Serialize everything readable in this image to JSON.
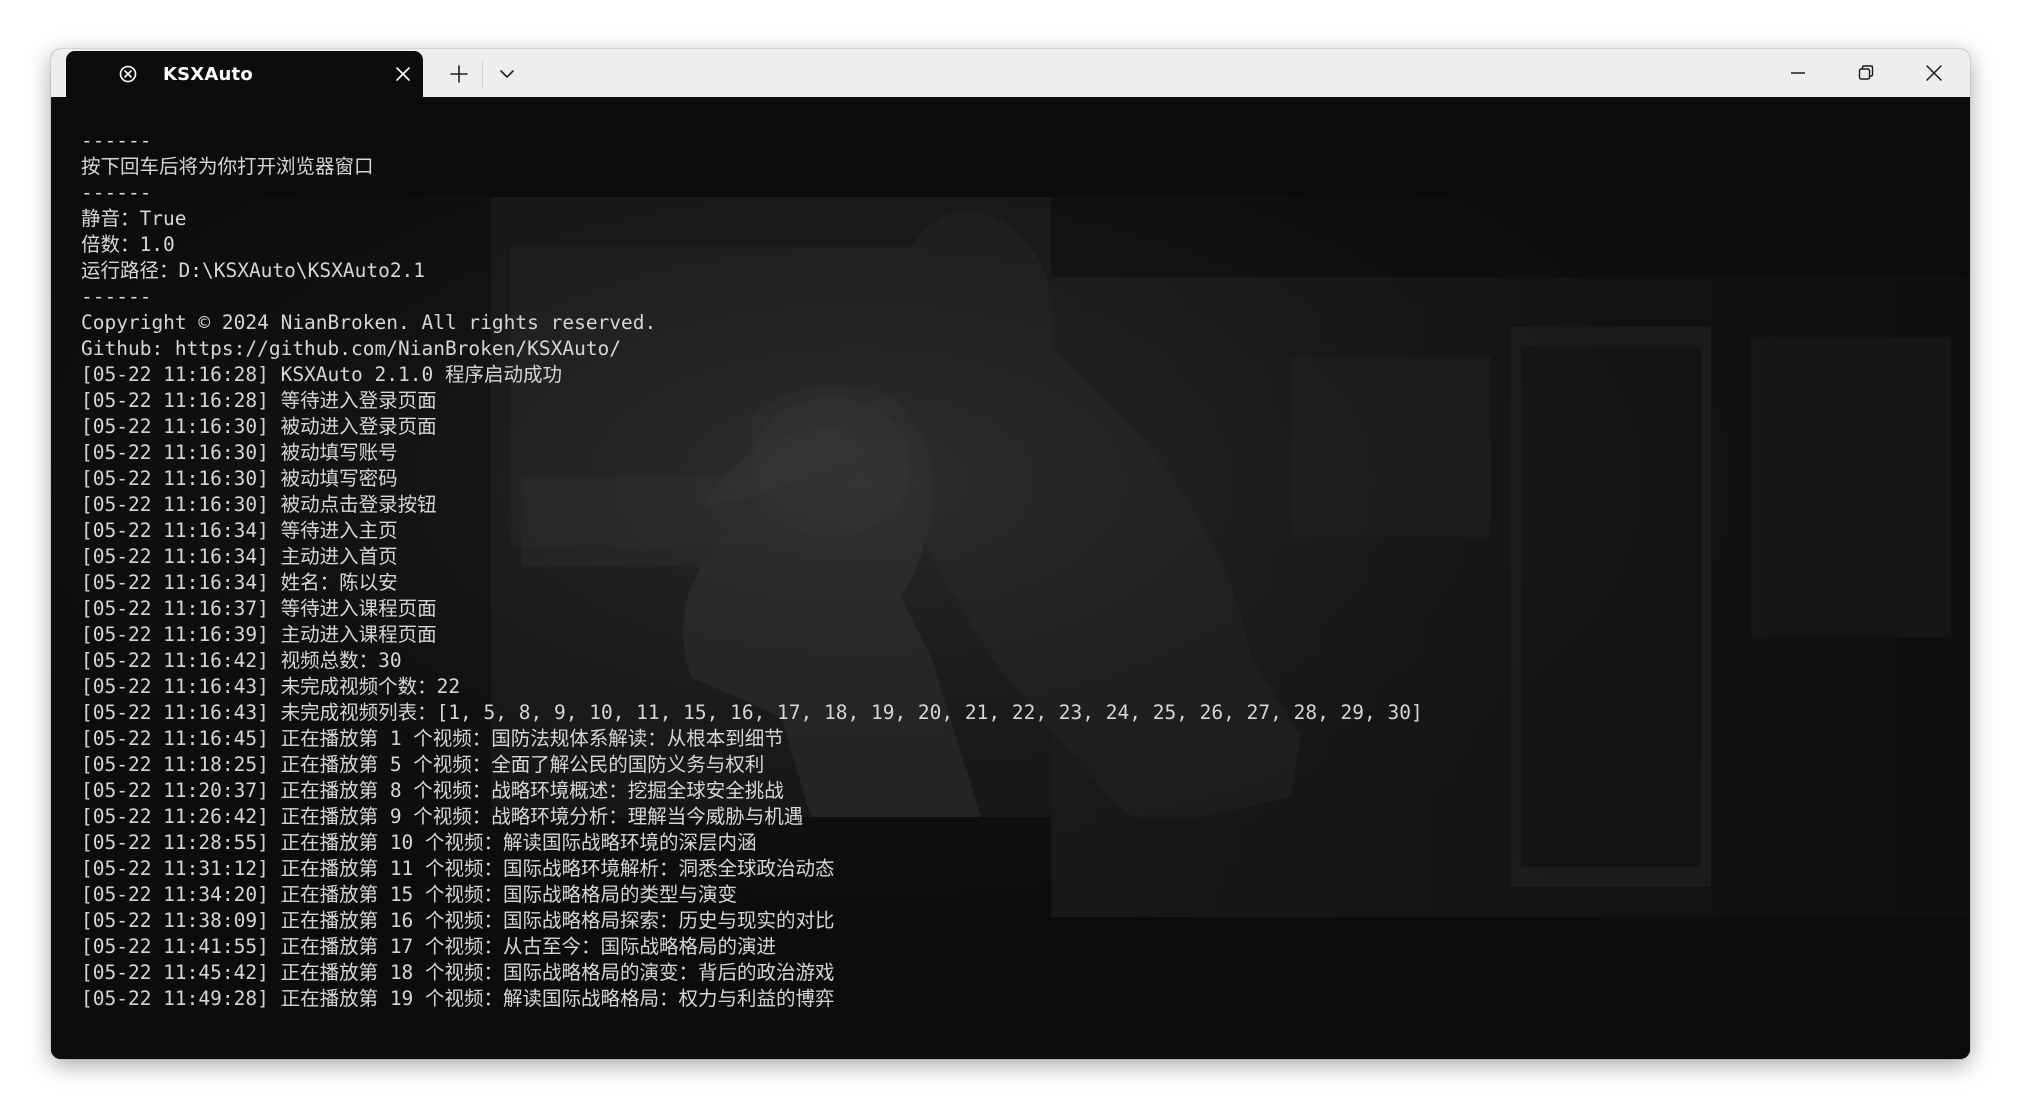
{
  "window": {
    "tab_title": "KSXAuto",
    "icons": {
      "tab_icon": "terminal-app-icon",
      "tab_close": "close-icon",
      "new_tab": "plus-icon",
      "dropdown": "chevron-down-icon",
      "minimize": "minimize-icon",
      "maximize": "restore-icon",
      "close": "close-icon"
    }
  },
  "colors": {
    "titlebar": "#eeeeee",
    "terminal_bg": "#0c0c0c",
    "terminal_text": "#d6d6d6"
  },
  "terminal": {
    "lines": [
      "------",
      "按下回车后将为你打开浏览器窗口",
      "------",
      "静音：True",
      "倍数：1.0",
      "运行路径：D:\\KSXAuto\\KSXAuto2.1",
      "------",
      "Copyright © 2024 NianBroken. All rights reserved.",
      "Github: https://github.com/NianBroken/KSXAuto/",
      "[05-22 11:16:28] KSXAuto 2.1.0 程序启动成功",
      "[05-22 11:16:28] 等待进入登录页面",
      "[05-22 11:16:30] 被动进入登录页面",
      "[05-22 11:16:30] 被动填写账号",
      "[05-22 11:16:30] 被动填写密码",
      "[05-22 11:16:30] 被动点击登录按钮",
      "[05-22 11:16:34] 等待进入主页",
      "[05-22 11:16:34] 主动进入首页",
      "[05-22 11:16:34] 姓名：陈以安",
      "[05-22 11:16:37] 等待进入课程页面",
      "[05-22 11:16:39] 主动进入课程页面",
      "[05-22 11:16:42] 视频总数：30",
      "[05-22 11:16:43] 未完成视频个数：22",
      "[05-22 11:16:43] 未完成视频列表：[1, 5, 8, 9, 10, 11, 15, 16, 17, 18, 19, 20, 21, 22, 23, 24, 25, 26, 27, 28, 29, 30]",
      "[05-22 11:16:45] 正在播放第 1 个视频：国防法规体系解读：从根本到细节",
      "[05-22 11:18:25] 正在播放第 5 个视频：全面了解公民的国防义务与权利",
      "[05-22 11:20:37] 正在播放第 8 个视频：战略环境概述：挖掘全球安全挑战",
      "[05-22 11:26:42] 正在播放第 9 个视频：战略环境分析：理解当今威胁与机遇",
      "[05-22 11:28:55] 正在播放第 10 个视频：解读国际战略环境的深层内涵",
      "[05-22 11:31:12] 正在播放第 11 个视频：国际战略环境解析：洞悉全球政治动态",
      "[05-22 11:34:20] 正在播放第 15 个视频：国际战略格局的类型与演变",
      "[05-22 11:38:09] 正在播放第 16 个视频：国际战略格局探索：历史与现实的对比",
      "[05-22 11:41:55] 正在播放第 17 个视频：从古至今：国际战略格局的演进",
      "[05-22 11:45:42] 正在播放第 18 个视频：国际战略格局的演变：背后的政治游戏",
      "[05-22 11:49:28] 正在播放第 19 个视频：解读国际战略格局：权力与利益的博弈"
    ]
  }
}
